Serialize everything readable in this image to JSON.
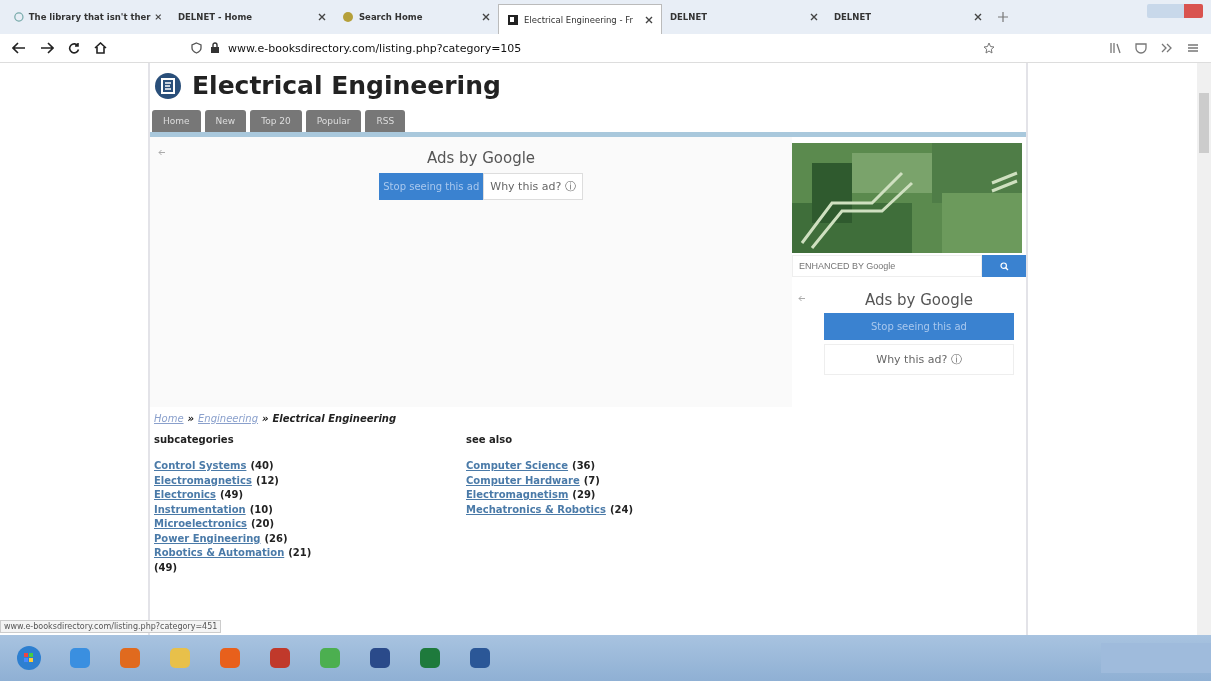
{
  "browser": {
    "tabs": [
      {
        "title": "The library that isn't ther",
        "selected": false
      },
      {
        "title": "DELNET - Home",
        "selected": false
      },
      {
        "title": "Search Home",
        "selected": false
      },
      {
        "title": "Electrical Engineering - Fr",
        "selected": true
      },
      {
        "title": "DELNET",
        "selected": false
      },
      {
        "title": "DELNET",
        "selected": false
      }
    ],
    "url": "www.e-booksdirectory.com/listing.php?category=105"
  },
  "page": {
    "title": "Electrical Engineering",
    "menu": [
      "Home",
      "New",
      "Top 20",
      "Popular",
      "RSS"
    ],
    "ad_main": {
      "heading": "Ads by Google",
      "stop": "Stop seeing this ad",
      "why": "Why this ad? ⓘ"
    },
    "search": {
      "placeholder": "ENHANCED BY Google"
    },
    "ad_side": {
      "heading": "Ads by Google",
      "stop": "Stop seeing this ad",
      "why": "Why this ad? ⓘ"
    },
    "breadcrumb_separator": "»",
    "breadcrumb": [
      {
        "label": "Home",
        "kind": "link"
      },
      {
        "label": "Engineering",
        "kind": "link"
      },
      {
        "label": "Electrical Engineering",
        "kind": "current"
      }
    ],
    "subcategories": {
      "heading": "subcategories",
      "items": [
        {
          "name": "Control Systems",
          "count": "(40)"
        },
        {
          "name": "Electromagnetics",
          "count": "(12)"
        },
        {
          "name": "Electronics",
          "count": "(49)"
        },
        {
          "name": "Instrumentation",
          "count": "(10)"
        },
        {
          "name": "Microelectronics",
          "count": "(20)"
        },
        {
          "name": "Power Engineering",
          "count": "(26)"
        },
        {
          "name": "Robotics & Automation",
          "count": "(21)"
        },
        {
          "count": "(49)"
        }
      ]
    },
    "see_also": {
      "heading": "see also",
      "items": [
        {
          "name": "Computer Science",
          "count": "(36)"
        },
        {
          "name": "Computer Hardware",
          "count": "(7)"
        },
        {
          "name": "Electromagnetism",
          "count": "(29)"
        },
        {
          "name": "Mechatronics & Robotics",
          "count": "(24)"
        }
      ]
    }
  },
  "status_url": "www.e-booksdirectory.com/listing.php?category=451"
}
